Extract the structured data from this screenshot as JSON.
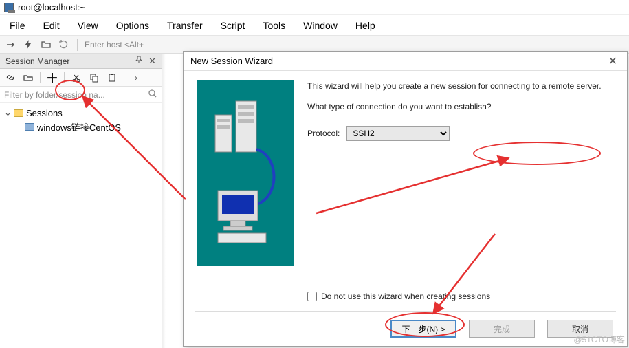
{
  "window": {
    "title": "root@localhost:~"
  },
  "menu": {
    "items": [
      "File",
      "Edit",
      "View",
      "Options",
      "Transfer",
      "Script",
      "Tools",
      "Window",
      "Help"
    ]
  },
  "toolbar": {
    "host_hint": "Enter host <Alt+"
  },
  "session_panel": {
    "title": "Session Manager",
    "filter_placeholder": "Filter by folder/session na...",
    "tree": {
      "root_label": "Sessions",
      "child_label": "windows链接CentOS"
    }
  },
  "dialog": {
    "title": "New Session Wizard",
    "intro": "This wizard will help you create a new session for connecting to a remote server.",
    "question": "What type of connection do you want to establish?",
    "protocol_label": "Protocol:",
    "protocol_value": "SSH2",
    "skip_checkbox": "Do not use this wizard when creating sessions",
    "buttons": {
      "next": "下一步(N) >",
      "finish": "完成",
      "cancel": "取消"
    }
  },
  "watermark": "@51CTO博客"
}
